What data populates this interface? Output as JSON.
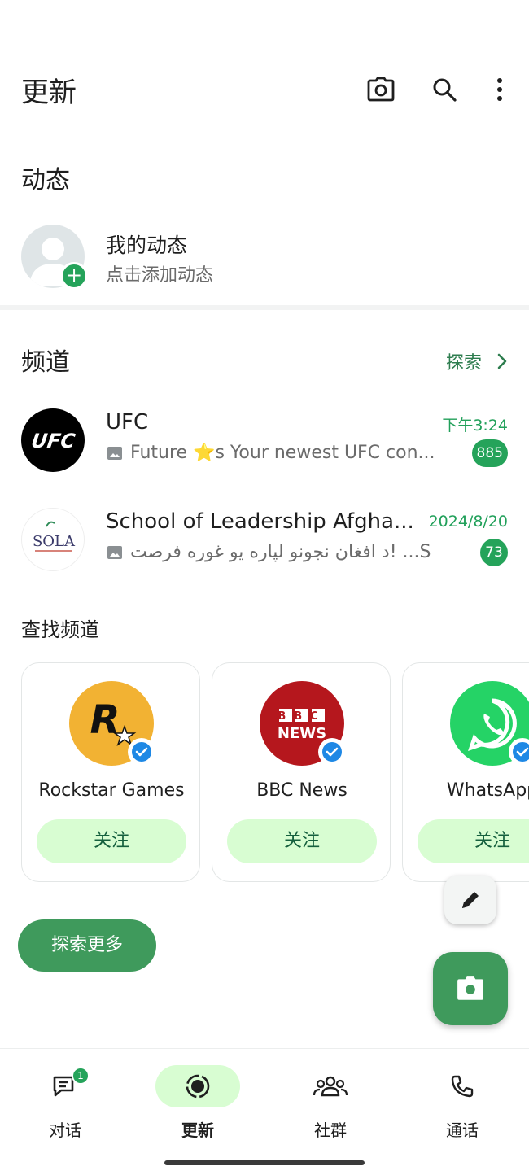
{
  "header": {
    "title": "更新",
    "icons": [
      "camera-icon",
      "search-icon",
      "more-vert-icon"
    ]
  },
  "status": {
    "section_title": "动态",
    "my_status_name": "我的动态",
    "my_status_hint": "点击添加动态"
  },
  "channels": {
    "section_title": "频道",
    "explore_label": "探索",
    "items": [
      {
        "name": "UFC",
        "time": "下午3:24",
        "message": "Future ⭐s  Your newest UFC con...",
        "unread": "885"
      },
      {
        "name": "School of Leadership Afgha...",
        "time": "2024/8/20",
        "message": "د افغان نجونو لپاره یو غوره فرصت! ...S",
        "unread": "73",
        "logo_text": "SOLA"
      }
    ]
  },
  "find_channels": {
    "section_title": "查找频道",
    "cards": [
      {
        "name": "Rockstar Games",
        "follow_label": "关注",
        "logo_text": "R"
      },
      {
        "name": "BBC News",
        "follow_label": "关注",
        "logo_text_top": "BBC",
        "logo_text_bottom": "NEWS"
      },
      {
        "name": "WhatsApp",
        "follow_label": "关注"
      }
    ],
    "explore_more_label": "探索更多"
  },
  "bottom_nav": {
    "items": [
      {
        "label": "对话",
        "icon": "chats-icon",
        "badge": "1"
      },
      {
        "label": "更新",
        "icon": "updates-icon",
        "active": true
      },
      {
        "label": "社群",
        "icon": "communities-icon"
      },
      {
        "label": "通话",
        "icon": "calls-icon"
      }
    ]
  },
  "colors": {
    "accent": "#25a35a",
    "accent_dark": "#3f9a5c",
    "follow_bg": "#d8fdd2"
  }
}
